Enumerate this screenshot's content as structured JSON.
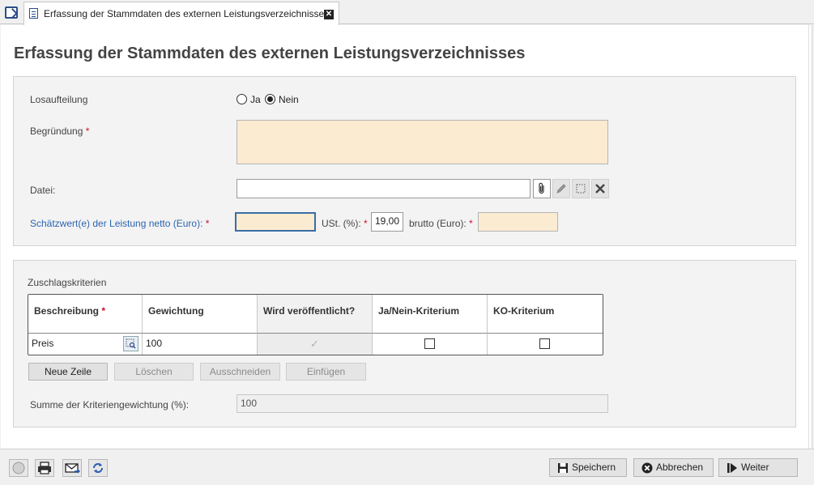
{
  "tab": {
    "label": "Erfassung der Stammdaten des externen Leistungsverzeichnisses"
  },
  "page": {
    "title": "Erfassung der Stammdaten des externen Leistungsverzeichnisses"
  },
  "form": {
    "losaufteilung_label": "Losaufteilung",
    "radio_ja": "Ja",
    "radio_nein": "Nein",
    "radio_selected": "Nein",
    "begruendung_label": "Begründung",
    "begruendung_value": "",
    "datei_label": "Datei:",
    "datei_value": "",
    "schaetzwert_label": "Schätzwert(e) der Leistung netto (Euro):",
    "schaetzwert_value": "",
    "ust_label": "USt. (%):",
    "ust_value": "19,00",
    "brutto_label": "brutto (Euro):",
    "brutto_value": "",
    "required_marker": "*"
  },
  "criteria": {
    "section_label": "Zuschlagskriterien",
    "columns": [
      "Beschreibung",
      "Gewichtung",
      "Wird veröffentlicht?",
      "Ja/Nein-Kriterium",
      "KO-Kriterium"
    ],
    "rows": [
      {
        "beschreibung": "Preis",
        "gewichtung": "100",
        "veroeffentlicht": true,
        "ja_nein": false,
        "ko": false
      }
    ],
    "buttons": {
      "new_row": "Neue Zeile",
      "delete": "Löschen",
      "cut": "Ausschneiden",
      "paste": "Einfügen"
    },
    "sum_label": "Summe der Kriteriengewichtung (%):",
    "sum_value": "100"
  },
  "footer": {
    "save": "Speichern",
    "cancel": "Abbrechen",
    "next": "Weiter"
  },
  "colors": {
    "required_bg": "#fbebd1",
    "accent_blue": "#2d64b0",
    "required_star": "#c8102e"
  }
}
